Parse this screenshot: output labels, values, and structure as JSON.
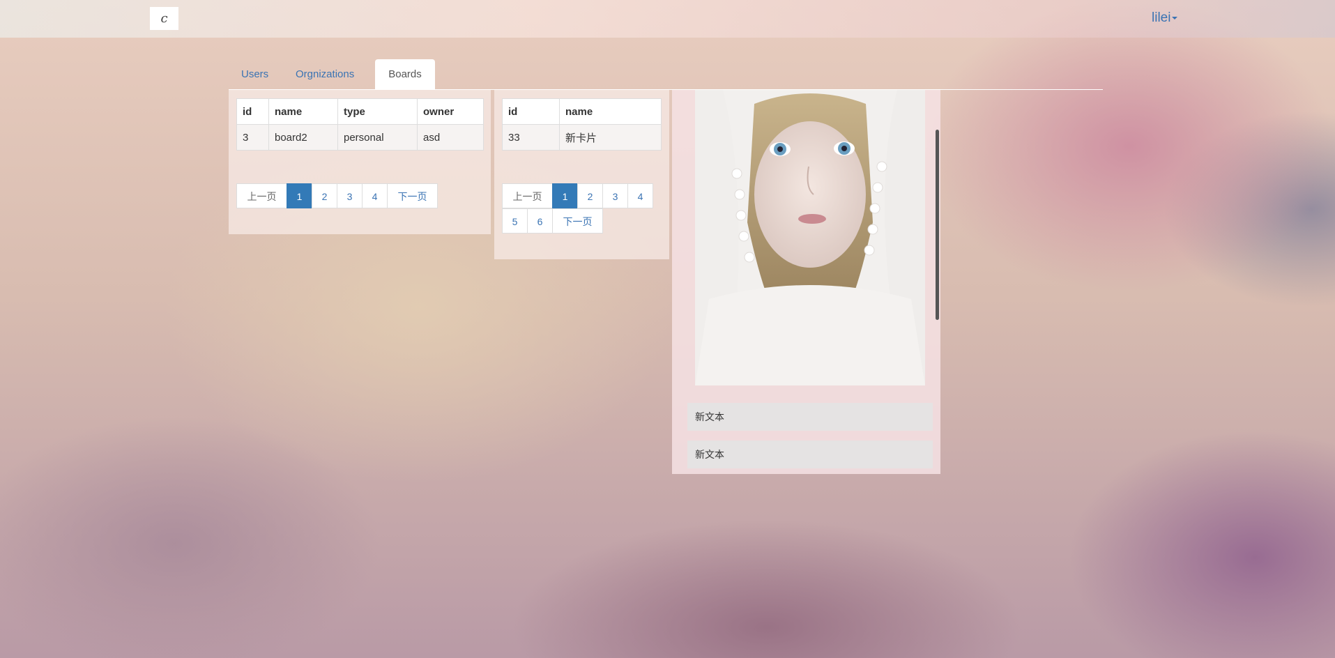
{
  "header": {
    "logo_glyph": "c",
    "user_name": "lilei"
  },
  "tabs": [
    {
      "label": "Users",
      "active": false
    },
    {
      "label": "Orgnizations",
      "active": false
    },
    {
      "label": "Boards",
      "active": true
    }
  ],
  "boards_table": {
    "columns": [
      "id",
      "name",
      "type",
      "owner"
    ],
    "rows": [
      [
        "3",
        "board2",
        "personal",
        "asd"
      ]
    ]
  },
  "boards_pagination": {
    "prev": "上一页",
    "pages": [
      "1",
      "2",
      "3",
      "4"
    ],
    "current": "1",
    "next": "下一页"
  },
  "cards_table": {
    "columns": [
      "id",
      "name"
    ],
    "rows": [
      [
        "33",
        "新卡片"
      ]
    ]
  },
  "cards_pagination": {
    "prev": "上一页",
    "pages": [
      "1",
      "2",
      "3",
      "4",
      "5",
      "6"
    ],
    "current": "1",
    "next": "下一页"
  },
  "card_detail": {
    "image_subject": "girl-portrait-image",
    "text_items": [
      "新文本",
      "新文本"
    ]
  },
  "colors": {
    "link": "#3a73b3",
    "active_page": "#337ab7"
  }
}
